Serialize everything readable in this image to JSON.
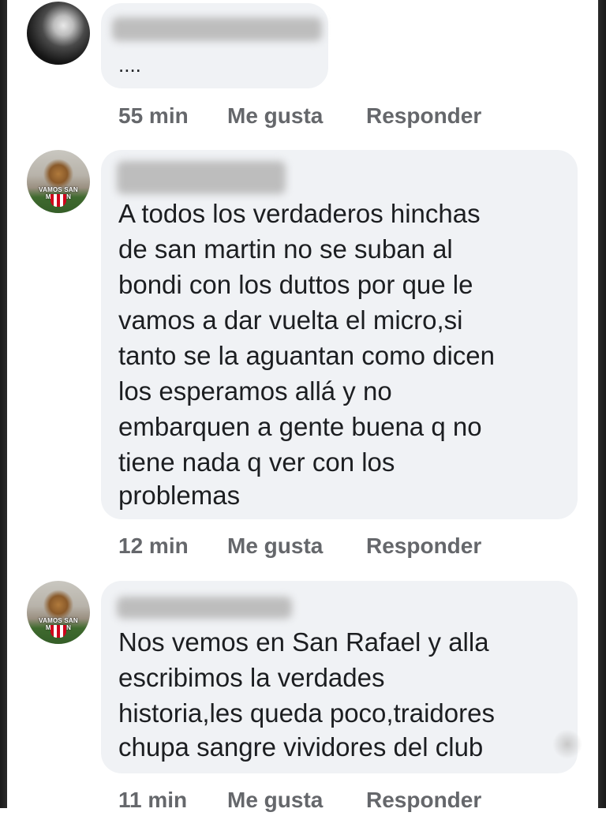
{
  "comments": [
    {
      "text_lines": [
        "...."
      ],
      "time": "55 min",
      "like_label": "Me gusta",
      "reply_label": "Responder"
    },
    {
      "text_lines": [
        "A todos los verdaderos  hinchas",
        "de san martin no se suban al",
        "bondi con los duttos por que le",
        "vamos  a dar vuelta el micro,si",
        "tanto se la aguantan como dicen",
        "los esperamos allá y no",
        "embarquen a gente buena q no",
        "tiene nada q ver con los",
        "problemas"
      ],
      "time": "12 min",
      "like_label": "Me gusta",
      "reply_label": "Responder",
      "avatar_caption": "VAMOS SAN MARTIN"
    },
    {
      "text_lines": [
        "Nos vemos en San Rafael y alla",
        "escribimos la verdades",
        "historia,les queda poco,traidores",
        "chupa sangre vividores  del club"
      ],
      "time": "11 min",
      "like_label": "Me gusta",
      "reply_label": "Responder",
      "avatar_caption": "VAMOS SAN MARTIN"
    }
  ],
  "colors": {
    "bubble": "#f0f2f5",
    "meta_text": "#65676b",
    "body_text": "#1c1e21"
  }
}
